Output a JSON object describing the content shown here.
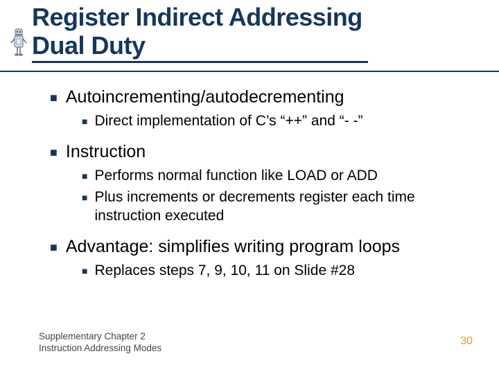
{
  "title_line1": "Register Indirect Addressing",
  "title_line2": "Dual Duty",
  "bullets": [
    {
      "text": "Autoincrementing/autodecrementing",
      "sub": [
        "Direct implementation of C’s “++” and “- -”"
      ]
    },
    {
      "text": "Instruction",
      "sub": [
        "Performs normal function like LOAD or ADD",
        "Plus increments or decrements register each time instruction executed"
      ]
    },
    {
      "text": "Advantage: simplifies writing program loops",
      "sub": [
        "Replaces steps 7, 9, 10, 11 on Slide #28"
      ]
    }
  ],
  "footer_line1": "Supplementary Chapter 2",
  "footer_line2": "Instruction Addressing Modes",
  "page_number": "30"
}
